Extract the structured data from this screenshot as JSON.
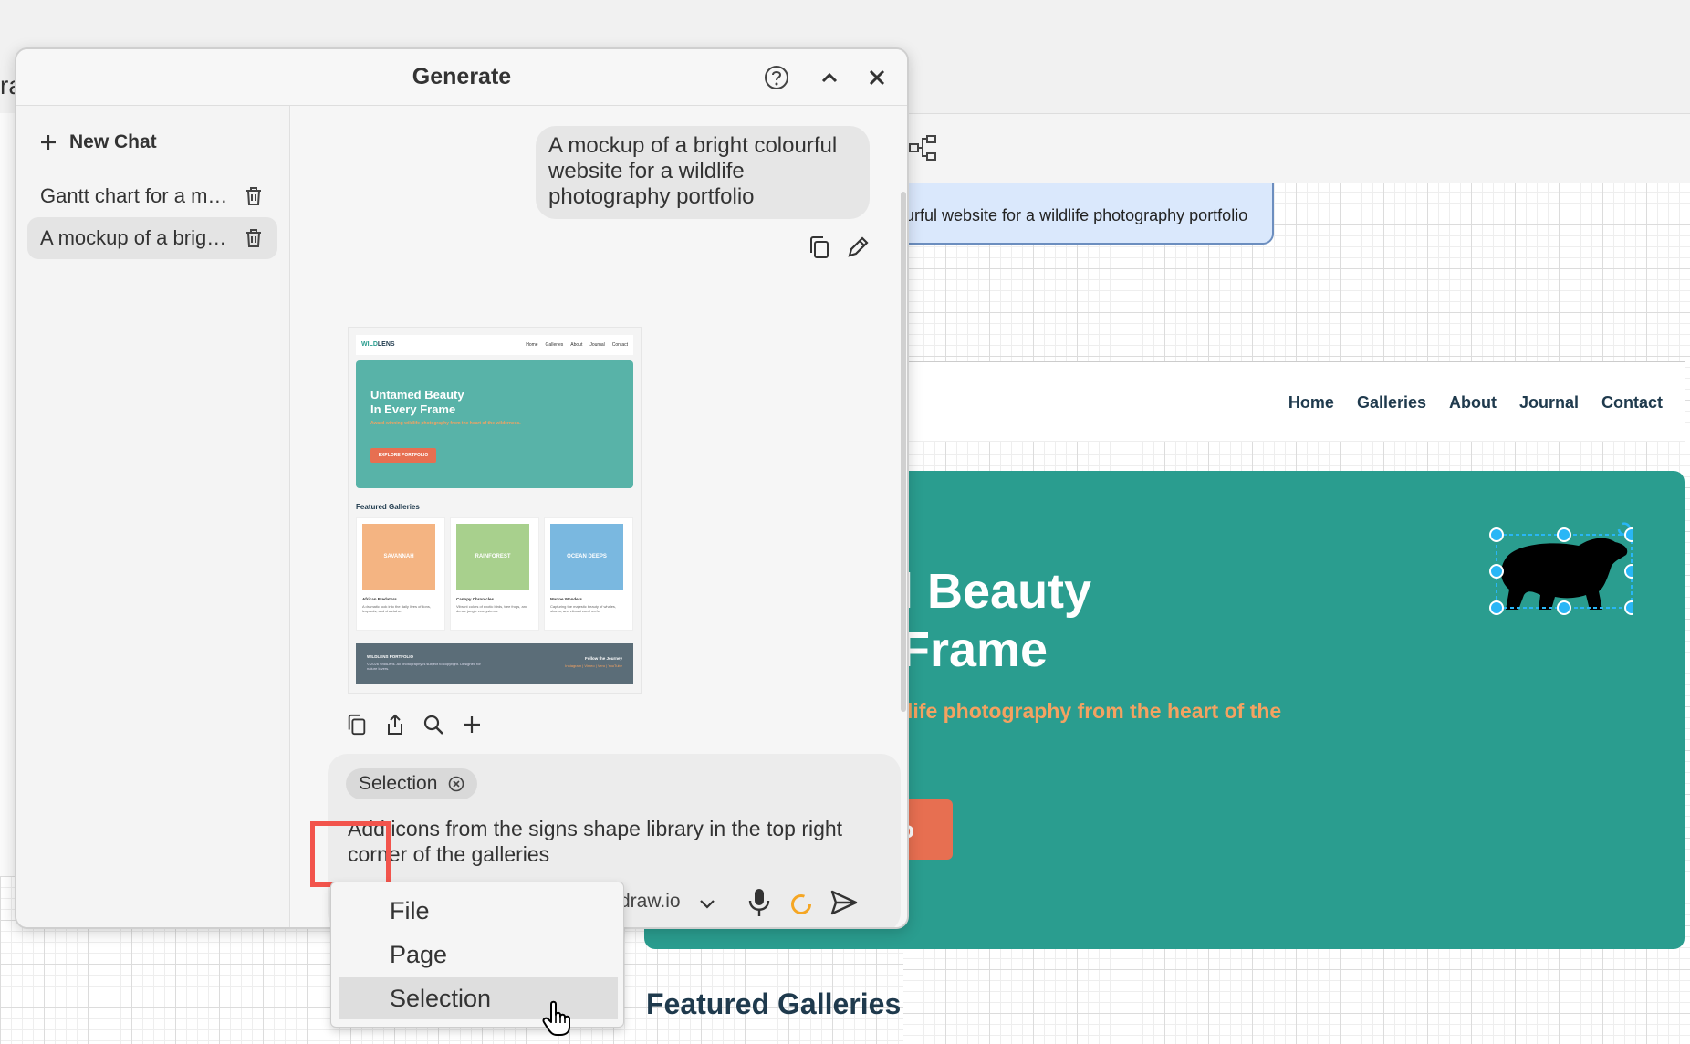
{
  "background": {
    "edge_char": "ra",
    "prompt_note": "urful website for a wildlife photography portfolio",
    "site_nav": [
      "Home",
      "Galleries",
      "About",
      "Journal",
      "Contact"
    ],
    "hero_title": "l Beauty\nFrame",
    "hero_subtitle": "life photography from the heart of the",
    "hero_button": "o",
    "featured_title": "Featured Galleries"
  },
  "dialog": {
    "title": "Generate",
    "help_icon": "help-circle-icon",
    "collapse_icon": "chevron-up-icon",
    "close_icon": "close-icon"
  },
  "sidebar": {
    "new_chat_label": "New Chat",
    "history": [
      {
        "label": "Gantt chart for a m…"
      },
      {
        "label": "A mockup of a brig…"
      }
    ]
  },
  "chat": {
    "user_message": "A mockup of a bright colourful website for a wildlife photography portfolio",
    "thumbnail": {
      "logo_a": "WILD",
      "logo_b": "LENS",
      "nav": [
        "Home",
        "Galleries",
        "About",
        "Journal",
        "Contact"
      ],
      "hero_title": "Untamed Beauty\nIn Every Frame",
      "hero_subtitle": "Award-winning wildlife photography from the heart of the wilderness.",
      "hero_button": "EXPLORE PORTFOLIO",
      "featured_title": "Featured Galleries",
      "cards": [
        {
          "label": "SAVANNAH",
          "title": "African Predators",
          "desc": "A dramatic look into the daily lives of lions, leopards, and cheetahs.",
          "color": "#f4b482"
        },
        {
          "label": "RAINFOREST",
          "title": "Canopy Chronicles",
          "desc": "Vibrant colors of exotic birds, tree frogs, and dense jungle ecosystems.",
          "color": "#a8d08d"
        },
        {
          "label": "OCEAN DEEPS",
          "title": "Marine Wonders",
          "desc": "Capturing the majestic beauty of whales, sharks, and vibrant coral reefs.",
          "color": "#7ab8e0"
        }
      ],
      "footer_brand": "WILDLENS PORTFOLIO",
      "footer_copy": "© 2026 WildLens. All photography is subject to copyright. Designed for nature lovers.",
      "footer_follow": "Follow the Journey",
      "footer_links": "Instagram | Vimeo | Vero | YouTube"
    }
  },
  "input": {
    "chip_label": "Selection",
    "prompt": "Add icons from the signs shape library in the top right corner of the galleries",
    "model": "draw.io"
  },
  "attach_menu": {
    "items": [
      "File",
      "Page",
      "Selection"
    ],
    "hovered": "Selection"
  },
  "colors": {
    "accent_highlight": "#f2544c",
    "hero_teal": "#2a9d8f",
    "hero_orange": "#f4a261",
    "button_coral": "#e76f51",
    "spinner": "#f5a623",
    "selection_handle": "#29b6f6"
  }
}
